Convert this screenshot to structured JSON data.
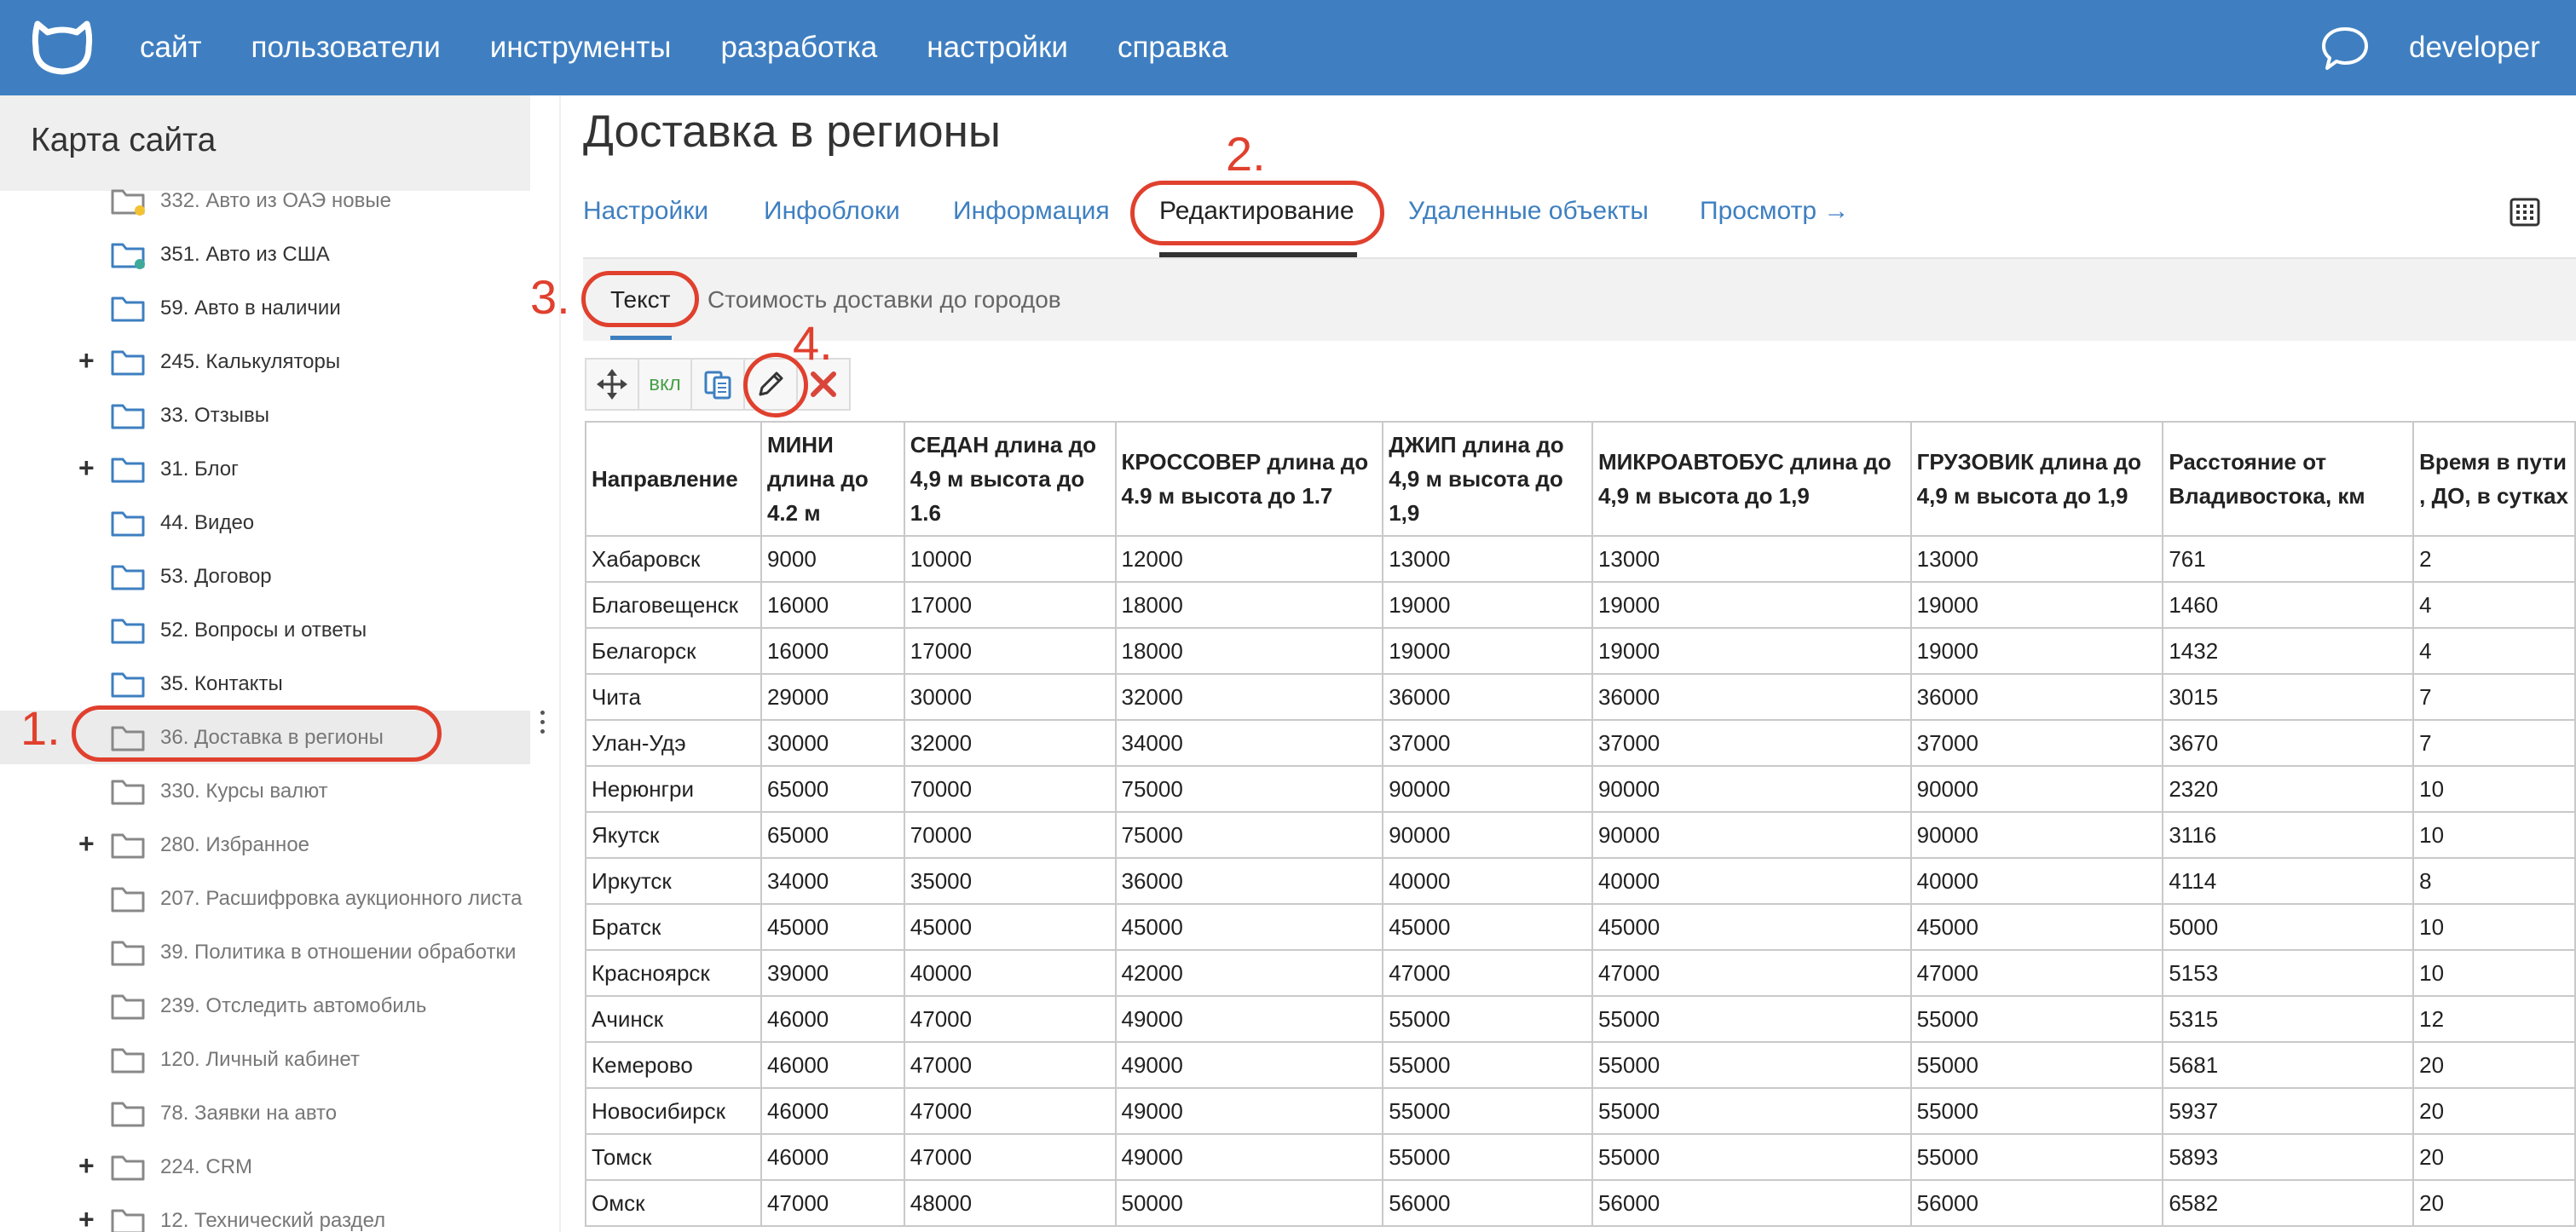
{
  "topbar": {
    "nav": [
      "сайт",
      "пользователи",
      "инструменты",
      "разработка",
      "настройки",
      "справка"
    ],
    "username": "developer",
    "bg_color": "#3f7fc1"
  },
  "sidebar": {
    "title": "Карта сайта",
    "items": [
      {
        "label": "332. Авто из ОАЭ новые",
        "plus": false,
        "status": "yellow",
        "style": "grey"
      },
      {
        "label": "351. Авто из США",
        "plus": false,
        "status": "teal",
        "style": "dark"
      },
      {
        "label": "59. Авто в наличии",
        "plus": false,
        "status": "",
        "style": "dark"
      },
      {
        "label": "245. Калькуляторы",
        "plus": true,
        "status": "",
        "style": "dark"
      },
      {
        "label": "33. Отзывы",
        "plus": false,
        "status": "",
        "style": "dark"
      },
      {
        "label": "31. Блог",
        "plus": true,
        "status": "",
        "style": "dark"
      },
      {
        "label": "44. Видео",
        "plus": false,
        "status": "",
        "style": "dark"
      },
      {
        "label": "53. Договор",
        "plus": false,
        "status": "",
        "style": "dark"
      },
      {
        "label": "52. Вопросы и ответы",
        "plus": false,
        "status": "",
        "style": "dark"
      },
      {
        "label": "35. Контакты",
        "plus": false,
        "status": "",
        "style": "dark"
      },
      {
        "label": "36. Доставка в регионы",
        "plus": false,
        "status": "",
        "style": "grey",
        "active": true
      },
      {
        "label": "330. Курсы валют",
        "plus": false,
        "status": "",
        "style": "grey"
      },
      {
        "label": "280. Избранное",
        "plus": true,
        "status": "",
        "style": "grey"
      },
      {
        "label": "207. Расшифровка аукционного листа",
        "plus": false,
        "status": "",
        "style": "grey"
      },
      {
        "label": "39. Политика в отношении обработки",
        "plus": false,
        "status": "",
        "style": "grey"
      },
      {
        "label": "239. Отследить автомобиль",
        "plus": false,
        "status": "",
        "style": "grey"
      },
      {
        "label": "120. Личный кабинет",
        "plus": false,
        "status": "",
        "style": "grey"
      },
      {
        "label": "78. Заявки на авто",
        "plus": false,
        "status": "",
        "style": "grey"
      },
      {
        "label": "224. CRM",
        "plus": true,
        "status": "",
        "style": "grey"
      },
      {
        "label": "12. Технический раздел",
        "plus": true,
        "status": "",
        "style": "grey"
      }
    ]
  },
  "main": {
    "title": "Доставка в регионы",
    "tabs": [
      {
        "label": "Настройки"
      },
      {
        "label": "Инфоблоки"
      },
      {
        "label": "Информация"
      },
      {
        "label": "Редактирование",
        "active": true
      },
      {
        "label": "Удаленные объекты"
      },
      {
        "label": "Просмотр →"
      }
    ],
    "subtabs": [
      {
        "label": "Текст",
        "active": true
      },
      {
        "label": "Стоимость доставки до городов"
      }
    ],
    "toolbar": {
      "on_label": "вкл"
    }
  },
  "annotations": [
    "1.",
    "2.",
    "3.",
    "4."
  ],
  "table": {
    "headers": [
      "Направление",
      "МИНИ длина до 4.2 м",
      "СЕДАН длина до 4,9 м высота до 1.6",
      "КРОССОВЕР длина до 4.9 м высота до 1.7",
      "ДЖИП длина до 4,9 м высота до 1,9",
      "МИКРОАВТОБУС длина до 4,9 м высота до 1,9",
      "ГРУЗОВИК длина до 4,9 м высота до 1,9",
      "Расстояние от Владивостока, км",
      "Время в пути , ДО, в сутках"
    ],
    "rows": [
      [
        "Хабаровск",
        "9000",
        "10000",
        "12000",
        "13000",
        "13000",
        "13000",
        "761",
        "2"
      ],
      [
        "Благовещенск",
        "16000",
        "17000",
        "18000",
        "19000",
        "19000",
        "19000",
        "1460",
        "4"
      ],
      [
        "Белагорск",
        "16000",
        "17000",
        "18000",
        "19000",
        "19000",
        "19000",
        "1432",
        "4"
      ],
      [
        "Чита",
        "29000",
        "30000",
        "32000",
        "36000",
        "36000",
        "36000",
        "3015",
        "7"
      ],
      [
        "Улан-Удэ",
        "30000",
        "32000",
        "34000",
        "37000",
        "37000",
        "37000",
        "3670",
        "7"
      ],
      [
        "Нерюнгри",
        "65000",
        "70000",
        "75000",
        "90000",
        "90000",
        "90000",
        "2320",
        "10"
      ],
      [
        "Якутск",
        "65000",
        "70000",
        "75000",
        "90000",
        "90000",
        "90000",
        "3116",
        "10"
      ],
      [
        "Иркутск",
        "34000",
        "35000",
        "36000",
        "40000",
        "40000",
        "40000",
        "4114",
        "8"
      ],
      [
        "Братск",
        "45000",
        "45000",
        "45000",
        "45000",
        "45000",
        "45000",
        "5000",
        "10"
      ],
      [
        "Красноярск",
        "39000",
        "40000",
        "42000",
        "47000",
        "47000",
        "47000",
        "5153",
        "10"
      ],
      [
        "Ачинск",
        "46000",
        "47000",
        "49000",
        "55000",
        "55000",
        "55000",
        "5315",
        "12"
      ],
      [
        "Кемерово",
        "46000",
        "47000",
        "49000",
        "55000",
        "55000",
        "55000",
        "5681",
        "20"
      ],
      [
        "Новосибирск",
        "46000",
        "47000",
        "49000",
        "55000",
        "55000",
        "55000",
        "5937",
        "20"
      ],
      [
        "Томск",
        "46000",
        "47000",
        "49000",
        "55000",
        "55000",
        "55000",
        "5893",
        "20"
      ],
      [
        "Омск",
        "47000",
        "48000",
        "50000",
        "56000",
        "56000",
        "56000",
        "6582",
        "20"
      ]
    ]
  },
  "colors": {
    "accent": "#3e7fc0",
    "annotation": "#e0402e",
    "on_green": "#4aa04a",
    "delete_red": "#d9453a"
  }
}
